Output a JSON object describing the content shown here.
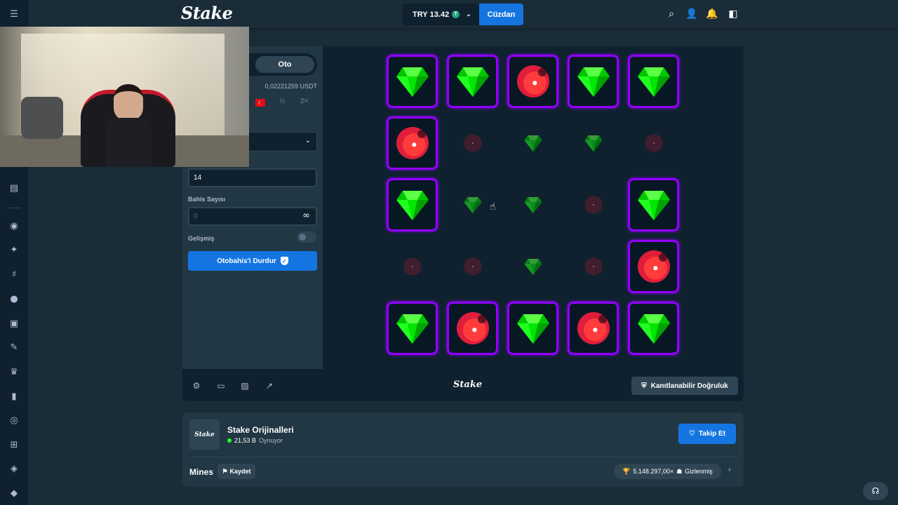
{
  "topbar": {
    "logo": "Stake",
    "balance_currency": "TRY",
    "balance_amount": "13.42",
    "coin_symbol": "T",
    "wallet_label": "Cüzdan"
  },
  "sidebar": {
    "mode_tab_auto": "Oto",
    "amount_usd": "0,02221259 USDT",
    "half_label": "½",
    "double_label": "2×",
    "mines_value": "14",
    "bet_count_label": "Bahis Sayısı",
    "bet_count_placeholder": "0",
    "advanced_label": "Gelişmiş",
    "stop_button_label": "Otobahis'i Durdur"
  },
  "board": {
    "tiles": [
      [
        "gem-sel",
        "gem-sel",
        "mine-sel",
        "gem-sel",
        "gem-sel"
      ],
      [
        "mine-sel",
        "mine-dim",
        "gem-dim",
        "gem-dim",
        "mine-dim"
      ],
      [
        "gem-sel",
        "gem-dim",
        "gem-dim",
        "mine-dim",
        "gem-sel"
      ],
      [
        "mine-dim",
        "mine-dim",
        "gem-dim",
        "mine-dim",
        "mine-sel"
      ],
      [
        "gem-sel",
        "mine-sel",
        "gem-sel",
        "mine-sel",
        "gem-sel"
      ]
    ]
  },
  "footer": {
    "logo": "Stake",
    "fair_label": "Kanıtlanabilir Doğruluk"
  },
  "info": {
    "logo_text": "Stake",
    "title": "Stake Orijinalleri",
    "players_count": "21,53 B",
    "players_label": "Oynuyor",
    "follow_label": "Takip Et",
    "game_name": "Mines",
    "save_label": "Kaydet",
    "max_multiplier": "5.148.297,00×",
    "hidden_label": "Gizlenmiş"
  },
  "colors": {
    "accent": "#1475e1",
    "selected_tile_border": "#9000ff",
    "gem": "#00e701",
    "mine": "#e01e3c"
  }
}
